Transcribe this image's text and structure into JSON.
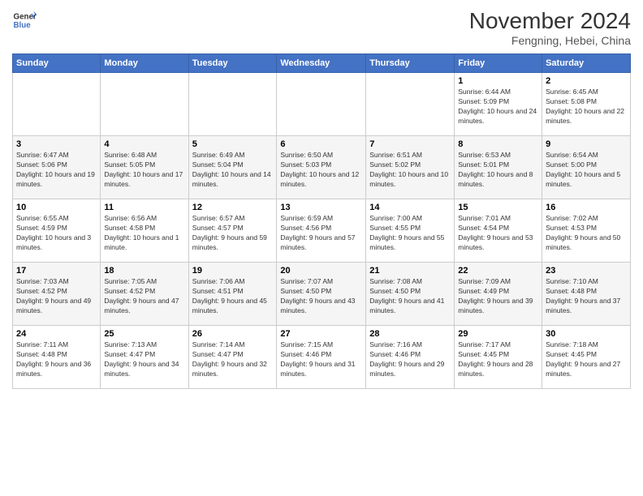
{
  "logo": {
    "line1": "General",
    "line2": "Blue"
  },
  "title": "November 2024",
  "subtitle": "Fengning, Hebei, China",
  "headers": [
    "Sunday",
    "Monday",
    "Tuesday",
    "Wednesday",
    "Thursday",
    "Friday",
    "Saturday"
  ],
  "weeks": [
    [
      {
        "day": "",
        "info": ""
      },
      {
        "day": "",
        "info": ""
      },
      {
        "day": "",
        "info": ""
      },
      {
        "day": "",
        "info": ""
      },
      {
        "day": "",
        "info": ""
      },
      {
        "day": "1",
        "info": "Sunrise: 6:44 AM\nSunset: 5:09 PM\nDaylight: 10 hours and 24 minutes."
      },
      {
        "day": "2",
        "info": "Sunrise: 6:45 AM\nSunset: 5:08 PM\nDaylight: 10 hours and 22 minutes."
      }
    ],
    [
      {
        "day": "3",
        "info": "Sunrise: 6:47 AM\nSunset: 5:06 PM\nDaylight: 10 hours and 19 minutes."
      },
      {
        "day": "4",
        "info": "Sunrise: 6:48 AM\nSunset: 5:05 PM\nDaylight: 10 hours and 17 minutes."
      },
      {
        "day": "5",
        "info": "Sunrise: 6:49 AM\nSunset: 5:04 PM\nDaylight: 10 hours and 14 minutes."
      },
      {
        "day": "6",
        "info": "Sunrise: 6:50 AM\nSunset: 5:03 PM\nDaylight: 10 hours and 12 minutes."
      },
      {
        "day": "7",
        "info": "Sunrise: 6:51 AM\nSunset: 5:02 PM\nDaylight: 10 hours and 10 minutes."
      },
      {
        "day": "8",
        "info": "Sunrise: 6:53 AM\nSunset: 5:01 PM\nDaylight: 10 hours and 8 minutes."
      },
      {
        "day": "9",
        "info": "Sunrise: 6:54 AM\nSunset: 5:00 PM\nDaylight: 10 hours and 5 minutes."
      }
    ],
    [
      {
        "day": "10",
        "info": "Sunrise: 6:55 AM\nSunset: 4:59 PM\nDaylight: 10 hours and 3 minutes."
      },
      {
        "day": "11",
        "info": "Sunrise: 6:56 AM\nSunset: 4:58 PM\nDaylight: 10 hours and 1 minute."
      },
      {
        "day": "12",
        "info": "Sunrise: 6:57 AM\nSunset: 4:57 PM\nDaylight: 9 hours and 59 minutes."
      },
      {
        "day": "13",
        "info": "Sunrise: 6:59 AM\nSunset: 4:56 PM\nDaylight: 9 hours and 57 minutes."
      },
      {
        "day": "14",
        "info": "Sunrise: 7:00 AM\nSunset: 4:55 PM\nDaylight: 9 hours and 55 minutes."
      },
      {
        "day": "15",
        "info": "Sunrise: 7:01 AM\nSunset: 4:54 PM\nDaylight: 9 hours and 53 minutes."
      },
      {
        "day": "16",
        "info": "Sunrise: 7:02 AM\nSunset: 4:53 PM\nDaylight: 9 hours and 50 minutes."
      }
    ],
    [
      {
        "day": "17",
        "info": "Sunrise: 7:03 AM\nSunset: 4:52 PM\nDaylight: 9 hours and 49 minutes."
      },
      {
        "day": "18",
        "info": "Sunrise: 7:05 AM\nSunset: 4:52 PM\nDaylight: 9 hours and 47 minutes."
      },
      {
        "day": "19",
        "info": "Sunrise: 7:06 AM\nSunset: 4:51 PM\nDaylight: 9 hours and 45 minutes."
      },
      {
        "day": "20",
        "info": "Sunrise: 7:07 AM\nSunset: 4:50 PM\nDaylight: 9 hours and 43 minutes."
      },
      {
        "day": "21",
        "info": "Sunrise: 7:08 AM\nSunset: 4:50 PM\nDaylight: 9 hours and 41 minutes."
      },
      {
        "day": "22",
        "info": "Sunrise: 7:09 AM\nSunset: 4:49 PM\nDaylight: 9 hours and 39 minutes."
      },
      {
        "day": "23",
        "info": "Sunrise: 7:10 AM\nSunset: 4:48 PM\nDaylight: 9 hours and 37 minutes."
      }
    ],
    [
      {
        "day": "24",
        "info": "Sunrise: 7:11 AM\nSunset: 4:48 PM\nDaylight: 9 hours and 36 minutes."
      },
      {
        "day": "25",
        "info": "Sunrise: 7:13 AM\nSunset: 4:47 PM\nDaylight: 9 hours and 34 minutes."
      },
      {
        "day": "26",
        "info": "Sunrise: 7:14 AM\nSunset: 4:47 PM\nDaylight: 9 hours and 32 minutes."
      },
      {
        "day": "27",
        "info": "Sunrise: 7:15 AM\nSunset: 4:46 PM\nDaylight: 9 hours and 31 minutes."
      },
      {
        "day": "28",
        "info": "Sunrise: 7:16 AM\nSunset: 4:46 PM\nDaylight: 9 hours and 29 minutes."
      },
      {
        "day": "29",
        "info": "Sunrise: 7:17 AM\nSunset: 4:45 PM\nDaylight: 9 hours and 28 minutes."
      },
      {
        "day": "30",
        "info": "Sunrise: 7:18 AM\nSunset: 4:45 PM\nDaylight: 9 hours and 27 minutes."
      }
    ]
  ]
}
